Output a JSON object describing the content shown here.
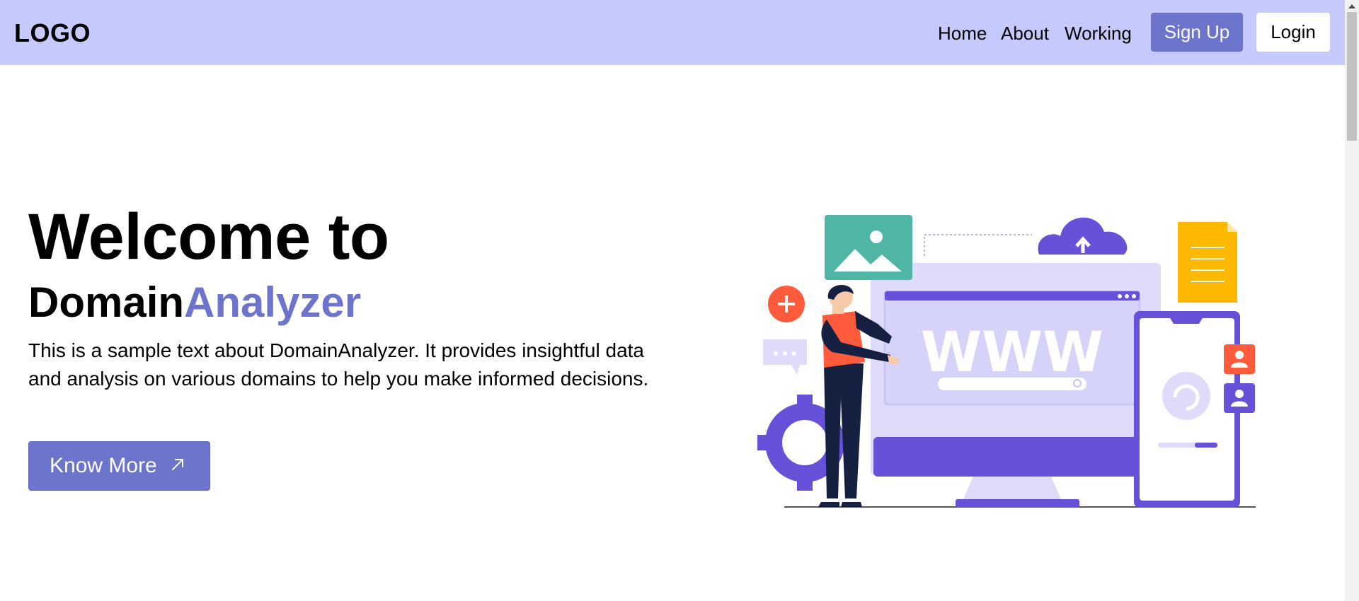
{
  "header": {
    "logo": "LOGO",
    "nav": {
      "home": "Home",
      "about": "About",
      "working": "Working"
    },
    "signup_label": "Sign Up",
    "login_label": "Login"
  },
  "hero": {
    "title": "Welcome to",
    "brand_part1": "Domain",
    "brand_part2": "Analyzer",
    "description": "This is a sample text about DomainAnalyzer. It provides insightful data and analysis on various domains to help you make informed decisions.",
    "cta_label": "Know More",
    "illustration_text": "WWW"
  },
  "colors": {
    "header_bg": "#c5c9fb",
    "accent": "#6c74cc",
    "illustration_purple": "#6552d8",
    "illustration_teal": "#4fb5a5",
    "illustration_orange": "#fe5b3c",
    "illustration_yellow": "#fdb900"
  },
  "icons": {
    "cta": "arrow-up-right-icon",
    "scroll": "scroll-up-arrow-icon"
  }
}
